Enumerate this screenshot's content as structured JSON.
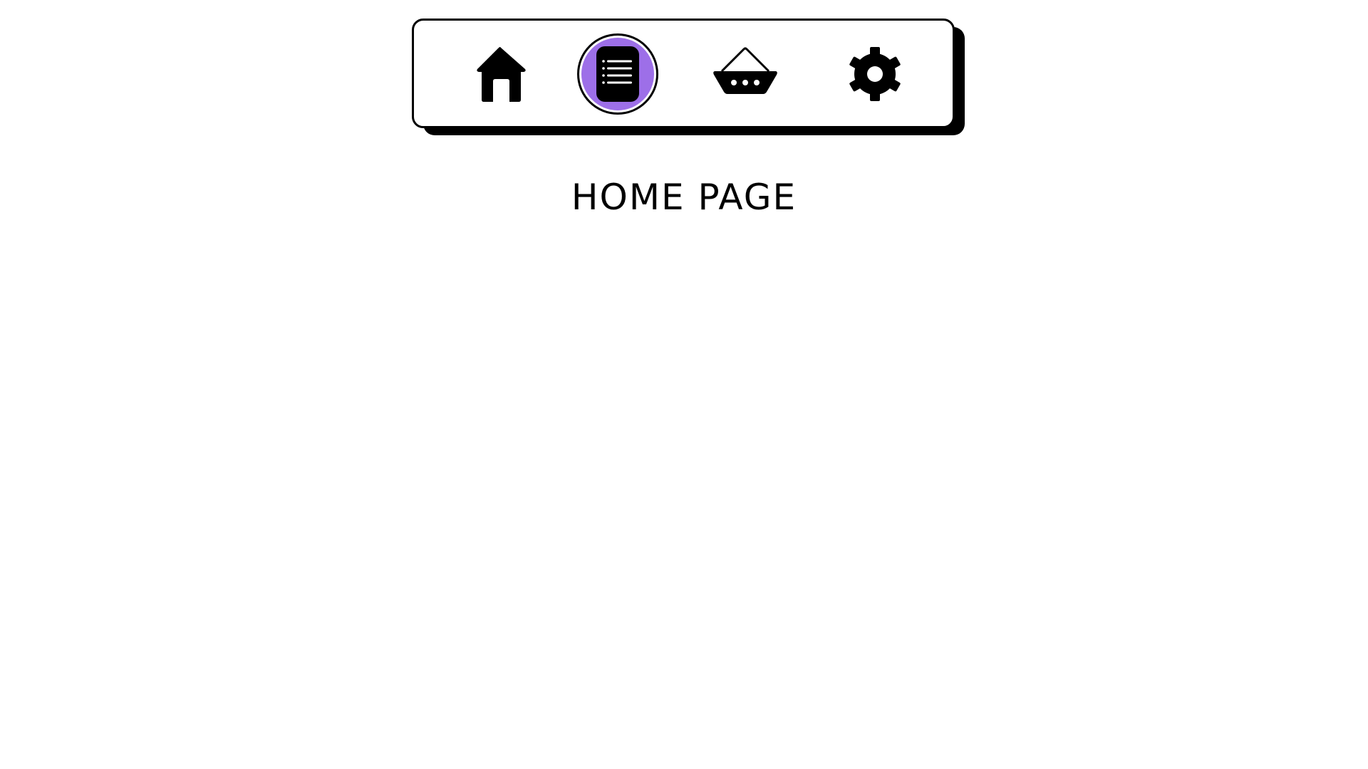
{
  "nav": {
    "active_index": 1,
    "active_color": "#9d6fe8",
    "items": [
      {
        "icon": "home-icon",
        "active": false
      },
      {
        "icon": "document-list-icon",
        "active": true
      },
      {
        "icon": "basket-icon",
        "active": false
      },
      {
        "icon": "gear-icon",
        "active": false
      }
    ]
  },
  "main": {
    "title": "HOME PAGE"
  }
}
